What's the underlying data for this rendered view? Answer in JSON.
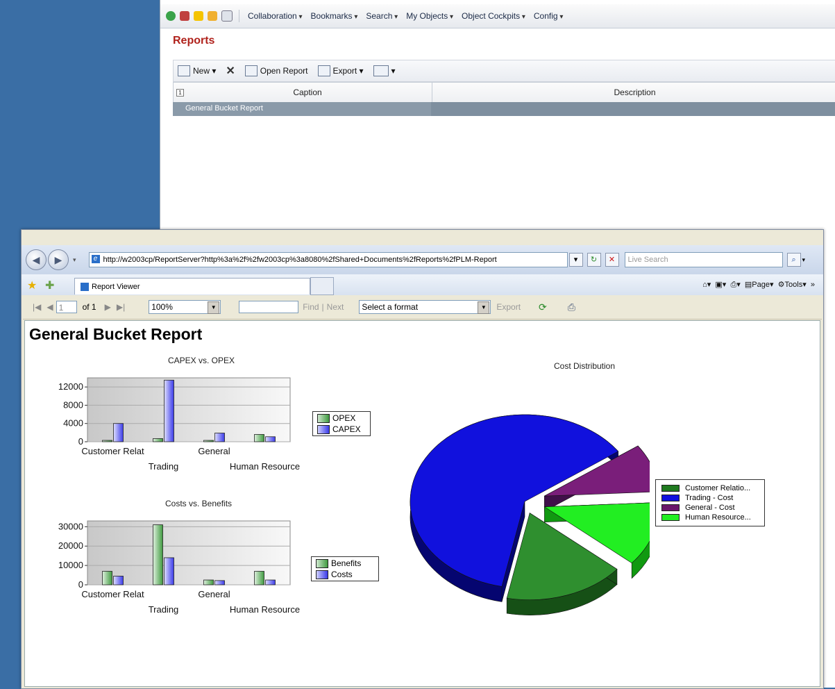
{
  "bg_app": {
    "menus": [
      "Collaboration",
      "Bookmarks",
      "Search",
      "My Objects",
      "Object Cockpits",
      "Config"
    ],
    "page_title": "Reports",
    "actions": {
      "new": "New",
      "open_report": "Open Report",
      "export": "Export"
    },
    "grid": {
      "columns": [
        "Caption",
        "Description"
      ],
      "expand_glyph": "1",
      "rows": [
        {
          "caption": "General Bucket Report",
          "description": ""
        }
      ]
    }
  },
  "browser": {
    "url": "http://w2003cp/ReportServer?http%3a%2f%2fw2003cp%3a8080%2fShared+Documents%2fReports%2fPLM-Report",
    "search_placeholder": "Live Search",
    "tab_title": "Report Viewer",
    "tools": {
      "page": "Page",
      "tools": "Tools"
    }
  },
  "report_viewer": {
    "page_current": "1",
    "page_of": "of 1",
    "zoom": "100%",
    "find_value": "",
    "find_label": "Find",
    "next_label": "Next",
    "format_placeholder": "Select a format",
    "export_label": "Export"
  },
  "report": {
    "title": "General Bucket Report"
  },
  "colors": {
    "opex_green": "#3f9a3f",
    "capex_blue": "#3a3ae8",
    "pie_green": "#2f8f2f",
    "pie_blue": "#1111dd",
    "pie_purple": "#7a1e7a",
    "pie_lime": "#22ee22",
    "report_title_red": "#b0221c"
  },
  "chart_data": [
    {
      "type": "bar",
      "title": "CAPEX vs. OPEX",
      "categories": [
        "Customer Relat",
        "Trading",
        "General",
        "Human Resource"
      ],
      "series": [
        {
          "name": "OPEX",
          "values": [
            300,
            700,
            300,
            1600
          ]
        },
        {
          "name": "CAPEX",
          "values": [
            4000,
            13500,
            1900,
            1100
          ]
        }
      ],
      "ylim": [
        0,
        14000
      ],
      "yticks": [
        0,
        4000,
        8000,
        12000
      ],
      "legend": "right"
    },
    {
      "type": "bar",
      "title": "Costs vs. Benefits",
      "categories": [
        "Customer Relat",
        "Trading",
        "General",
        "Human Resource"
      ],
      "series": [
        {
          "name": "Benefits",
          "values": [
            7000,
            31000,
            2500,
            7000
          ]
        },
        {
          "name": "Costs",
          "values": [
            4500,
            14000,
            2200,
            2500
          ]
        }
      ],
      "ylim": [
        0,
        33000
      ],
      "yticks": [
        0,
        10000,
        20000,
        30000
      ],
      "legend": "right"
    },
    {
      "type": "pie",
      "title": "Cost Distribution",
      "slices": [
        {
          "name": "Customer Relatio...",
          "value": 17
        },
        {
          "name": "Trading - Cost",
          "value": 62
        },
        {
          "name": "General - Cost",
          "value": 9
        },
        {
          "name": "Human Resource...",
          "value": 12
        }
      ],
      "legend": "right"
    }
  ]
}
